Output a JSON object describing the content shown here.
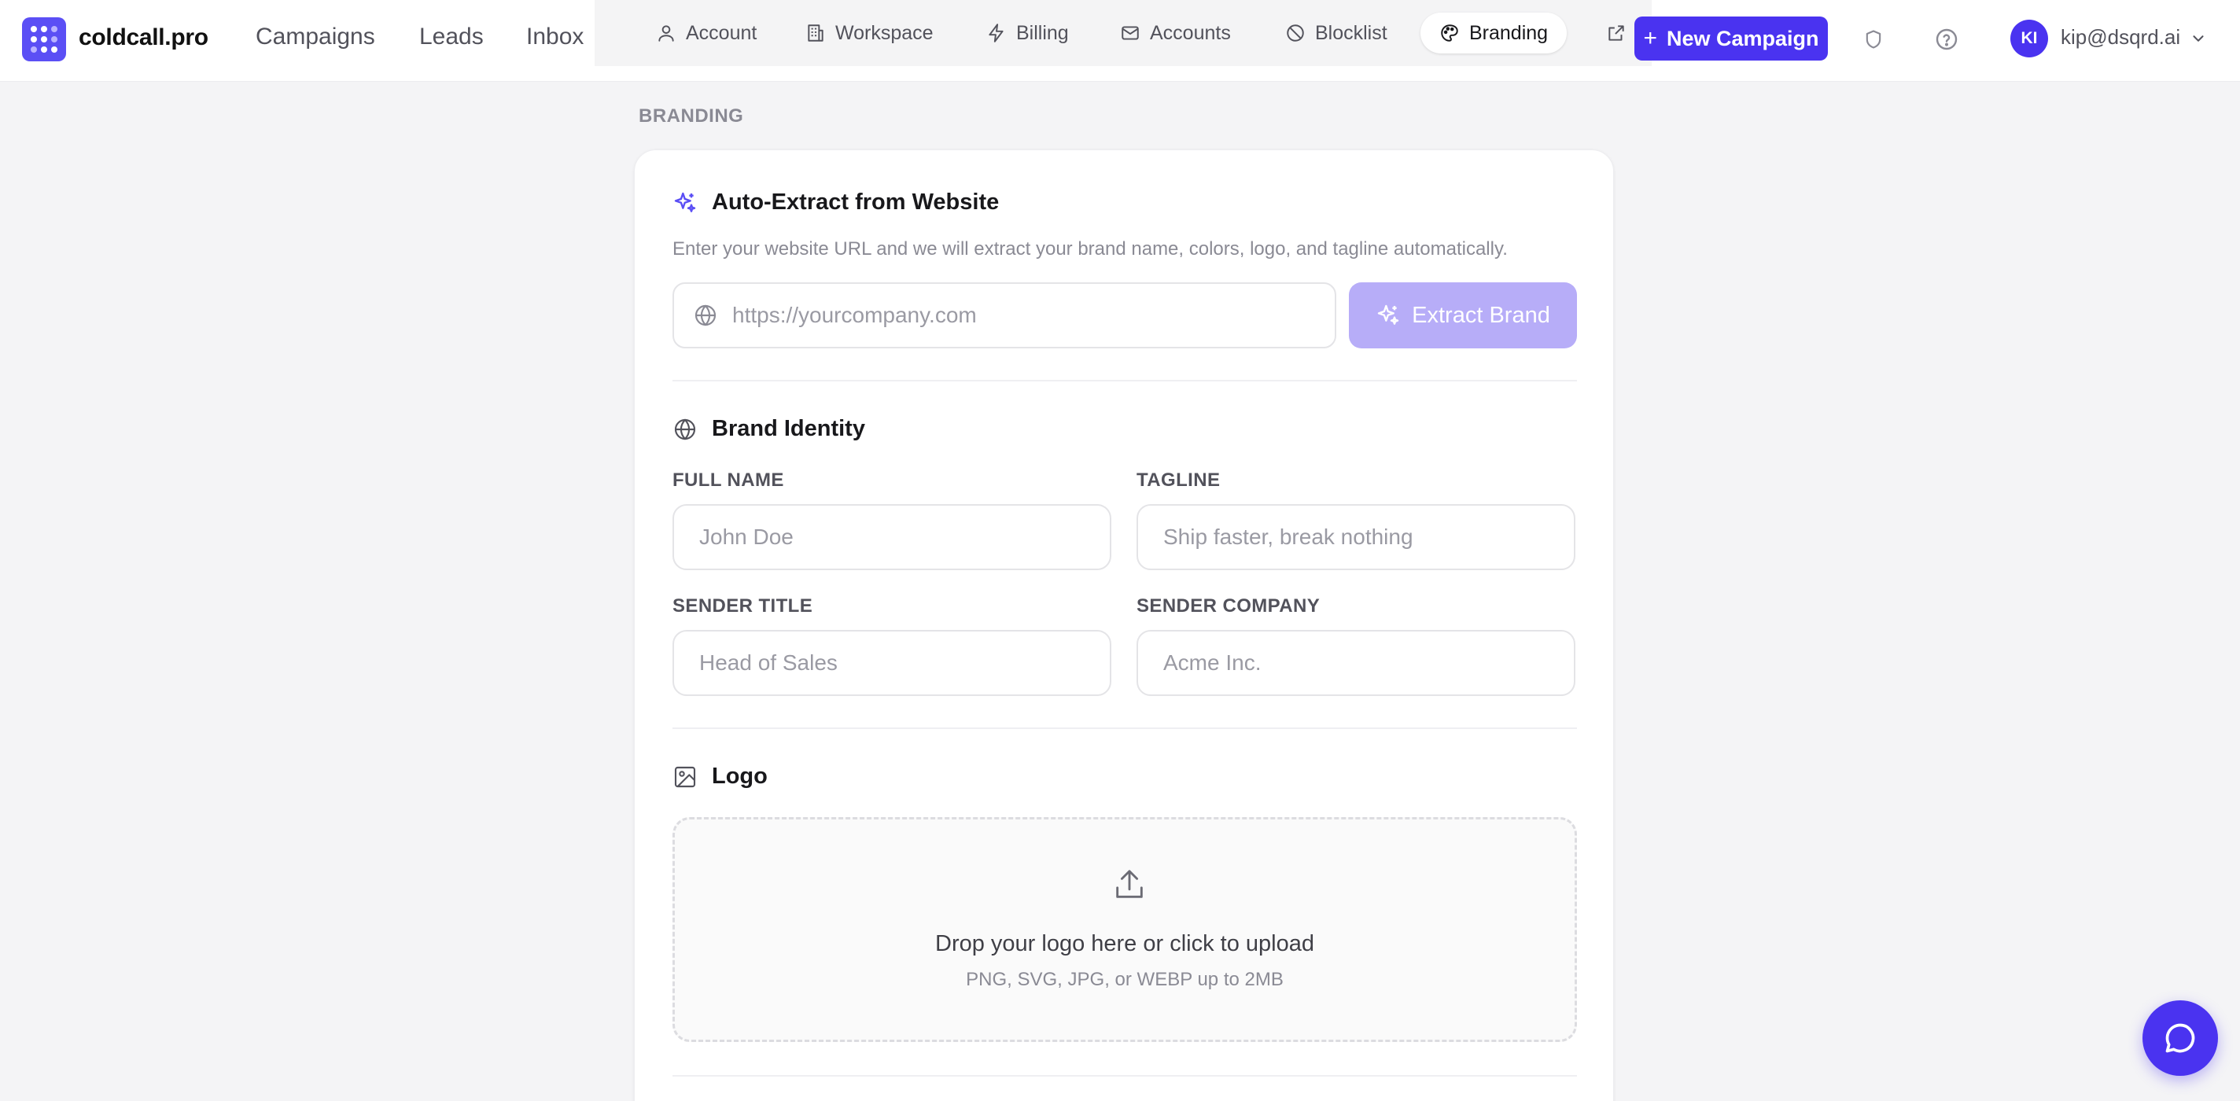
{
  "app": {
    "brand_name": "coldcall.pro",
    "nav": [
      "Campaigns",
      "Leads",
      "Inbox"
    ]
  },
  "settings_tabs": [
    {
      "label": "Account",
      "icon": "user-icon"
    },
    {
      "label": "Workspace",
      "icon": "building-icon"
    },
    {
      "label": "Billing",
      "icon": "lightning-icon"
    },
    {
      "label": "Accounts",
      "icon": "mail-icon"
    },
    {
      "label": "Blocklist",
      "icon": "ban-icon"
    },
    {
      "label": "Branding",
      "icon": "palette-icon",
      "active": true
    },
    {
      "label": "",
      "icon": "external-icon"
    }
  ],
  "header": {
    "new_campaign_label": "New Campaign",
    "user_initials": "KI",
    "user_email": "kip@dsqrd.ai"
  },
  "page": {
    "section_label": "BRANDING"
  },
  "auto_extract": {
    "title": "Auto-Extract from Website",
    "helper": "Enter your website URL and we will extract your brand name, colors, logo, and tagline automatically.",
    "url_placeholder": "https://yourcompany.com",
    "url_value": "",
    "button_label": "Extract Brand"
  },
  "brand_identity": {
    "title": "Brand Identity",
    "fields": {
      "full_name": {
        "label": "FULL NAME",
        "placeholder": "John Doe",
        "value": ""
      },
      "tagline": {
        "label": "TAGLINE",
        "placeholder": "Ship faster, break nothing",
        "value": ""
      },
      "sender_title": {
        "label": "SENDER TITLE",
        "placeholder": "Head of Sales",
        "value": ""
      },
      "sender_company": {
        "label": "SENDER COMPANY",
        "placeholder": "Acme Inc.",
        "value": ""
      }
    }
  },
  "logo": {
    "title": "Logo",
    "drop_title": "Drop your logo here or click to upload",
    "drop_sub": "PNG, SVG, JPG, or WEBP up to 2MB"
  },
  "colors": {
    "accent": "#4a33f0",
    "accent_disabled": "#b7adf8",
    "page_bg": "#f4f4f6"
  }
}
